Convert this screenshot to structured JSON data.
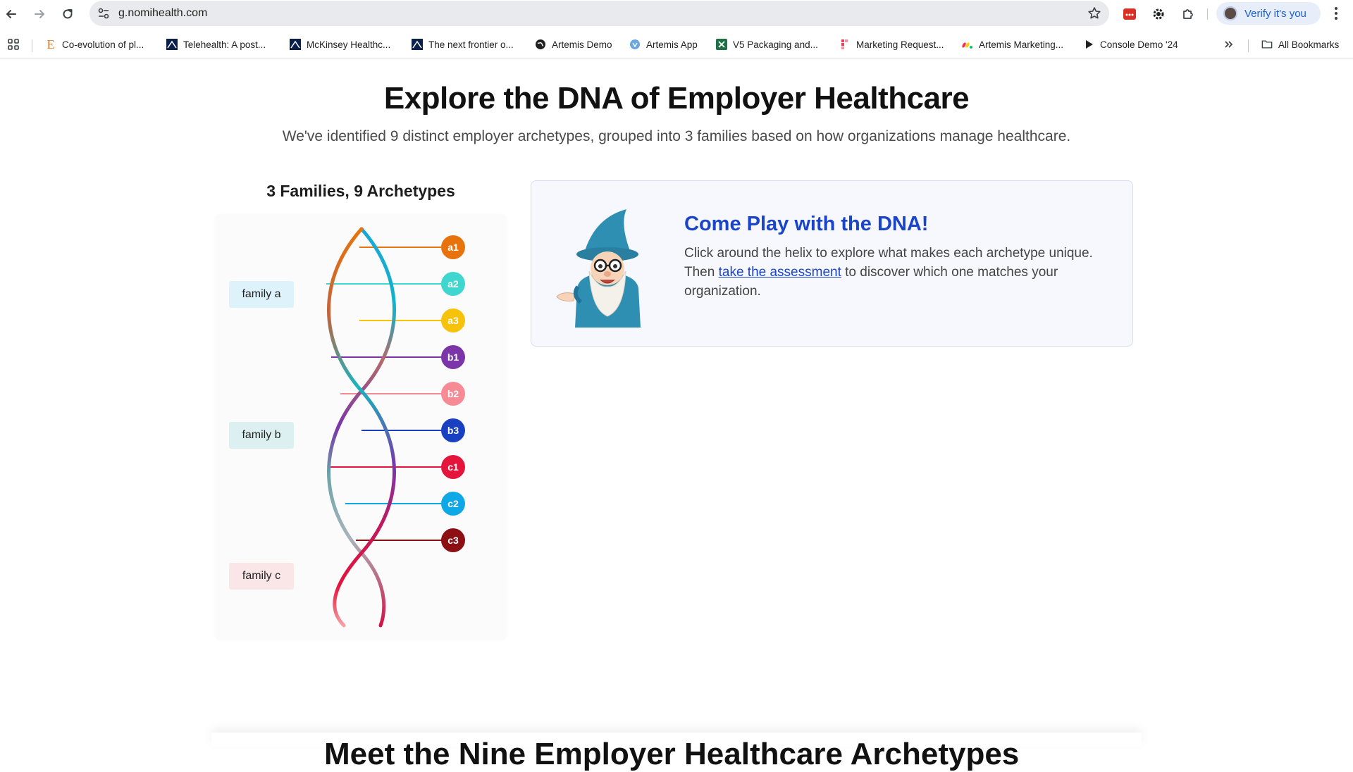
{
  "browser": {
    "url": "g.nomihealth.com",
    "profile_label": "Verify it's you",
    "bookmarks": [
      {
        "label": "Co-evolution of pl...",
        "icon": "e-letter-icon"
      },
      {
        "label": "Telehealth: A post...",
        "icon": "mckinsey-icon"
      },
      {
        "label": "McKinsey Healthc...",
        "icon": "mckinsey-icon"
      },
      {
        "label": "The next frontier o...",
        "icon": "mckinsey-icon"
      },
      {
        "label": "Artemis Demo",
        "icon": "globe-icon"
      },
      {
        "label": "Artemis App",
        "icon": "shield-icon"
      },
      {
        "label": "V5 Packaging and...",
        "icon": "excel-icon"
      },
      {
        "label": "Marketing Request...",
        "icon": "form-icon"
      },
      {
        "label": "Artemis Marketing...",
        "icon": "monday-icon"
      },
      {
        "label": "Console Demo '24",
        "icon": "play-icon"
      }
    ],
    "all_bookmarks_label": "All Bookmarks"
  },
  "page": {
    "title": "Explore the DNA of Employer Healthcare",
    "subtitle": "We've identified 9 distinct employer archetypes, grouped into 3 families based on how organizations manage healthcare.",
    "helix_heading": "3 Families, 9 Archetypes",
    "families": [
      {
        "label": "family a",
        "bg": "#def2fb"
      },
      {
        "label": "family b",
        "bg": "#dcf0f1"
      },
      {
        "label": "family c",
        "bg": "#fbe6e7"
      }
    ],
    "archetypes": [
      {
        "label": "a1",
        "color": "#e8730c"
      },
      {
        "label": "a2",
        "color": "#3fd6cf"
      },
      {
        "label": "a3",
        "color": "#f7c20a"
      },
      {
        "label": "b1",
        "color": "#7b35a8"
      },
      {
        "label": "b2",
        "color": "#f78b95"
      },
      {
        "label": "b3",
        "color": "#1840c0"
      },
      {
        "label": "c1",
        "color": "#e5143c"
      },
      {
        "label": "c2",
        "color": "#0fa8e6"
      },
      {
        "label": "c3",
        "color": "#8c0f14"
      }
    ],
    "card": {
      "title": "Come Play with the DNA!",
      "body_before": "Click around the helix to explore what makes each archetype unique. Then ",
      "link": "take the assessment",
      "body_after": " to discover which one matches your organization."
    },
    "next_heading": "Meet the Nine Employer Healthcare Archetypes"
  }
}
